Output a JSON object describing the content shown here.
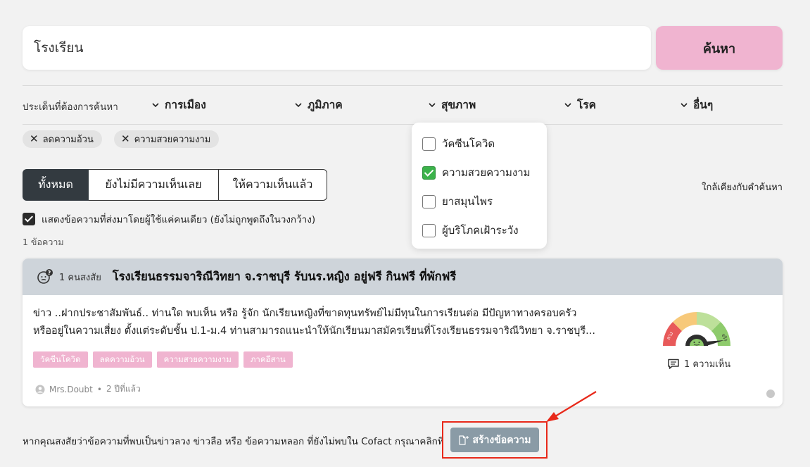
{
  "search": {
    "value": "โรงเรียน",
    "button_label": "ค้นหา"
  },
  "filters": {
    "label": "ประเด็นที่ต้องการค้นหา",
    "categories": [
      "การเมือง",
      "ภูมิภาค",
      "สุขภาพ",
      "โรค",
      "อื่นๆ"
    ]
  },
  "active_chips": [
    "ลดความอ้วน",
    "ความสวยความงาม"
  ],
  "dropdown": {
    "items": [
      {
        "label": "วัคซีนโควิด",
        "checked": false
      },
      {
        "label": "ความสวยความงาม",
        "checked": true
      },
      {
        "label": "ยาสมุนไพร",
        "checked": false
      },
      {
        "label": "ผู้บริโภคเฝ้าระวัง",
        "checked": false
      }
    ]
  },
  "tabs": [
    "ทั้งหมด",
    "ยังไม่มีความเห็นเลย",
    "ให้ความเห็นแล้ว"
  ],
  "sort_label": "ใกล้เคียงกับคำค้นหา",
  "single_sender_check": "แสดงข้อความที่ส่งมาโดยผู้ใช้แค่คนเดียว (ยังไม่ถูกพูดถึงในวงกว้าง)",
  "result_count": "1 ข้อความ",
  "card": {
    "doubt_count": "1 คนสงสัย",
    "title": "โรงเรียนธรรมจาริณีวิทยา จ.ราชบุรี รับนร.หญิง อยู่ฟรี กินฟรี ที่พักฟรี",
    "body_line1": "ข่าว ..ฝากประชาสัมพันธ์.. ท่านใด พบเห็น หรือ รู้จัก นักเรียนหญิงที่ขาดทุนทรัพย์ไม่มีทุนในการเรียนต่อ มีปัญหาทางครอบครัว",
    "body_line2": "หรืออยู่ในความเสี่ยง ตั้งแต่ระดับชั้น ป.1-ม.4 ท่านสามารถแนะนำให้นักเรียนมาสมัครเรียนที่โรงเรียนธรรมจาริณีวิทยา จ.ราชบุรี...",
    "tags": [
      "วัคซีนโควิด",
      "ลดความอ้วน",
      "ความสวยความงาม",
      "ภาคอีสาน"
    ],
    "author": "Mrs.Doubt",
    "time": "2 ปีที่แล้ว",
    "gauge_left_label": "ลวง",
    "gauge_right_label": "จริง",
    "reply_count": "1 ความเห็น"
  },
  "footer": {
    "text": "หากคุณสงสัยว่าข้อความที่พบเป็นข่าวลวง ข่าวลือ หรือ ข้อความหลอก ที่ยังไม่พบใน Cofact กรุณาคลิกที่",
    "create_button": "สร้างข้อความ"
  },
  "colors": {
    "accent_pink": "#f0b4d0",
    "dark": "#333a40",
    "annotation_red": "#e8291a",
    "checkbox_green": "#3bb24a"
  }
}
